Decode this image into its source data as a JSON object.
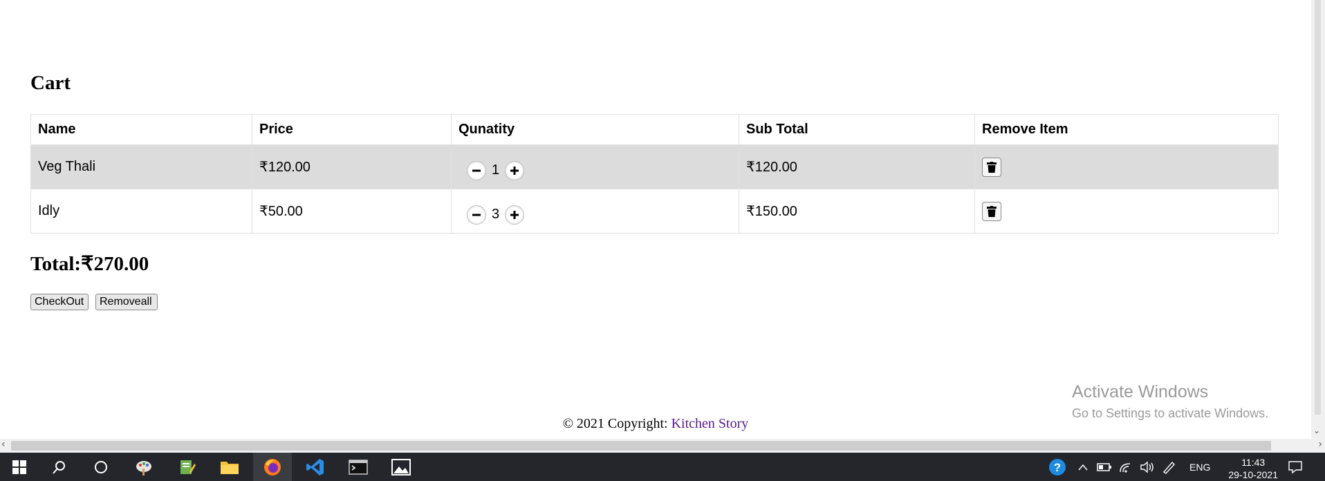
{
  "cart": {
    "title": "Cart",
    "columns": [
      "Name",
      "Price",
      "Qunatity",
      "Sub Total",
      "Remove Item"
    ],
    "rows": [
      {
        "name": "Veg Thali",
        "price": "₹120.00",
        "quantity": "1",
        "subtotal": "₹120.00"
      },
      {
        "name": "Idly",
        "price": "₹50.00",
        "quantity": "3",
        "subtotal": "₹150.00"
      }
    ],
    "total": "Total:₹270.00",
    "checkout_label": "CheckOut",
    "removeall_label": "Removeall"
  },
  "footer": {
    "copyright": "© 2021 Copyright: ",
    "link": "Kitchen Story"
  },
  "watermark": {
    "line1": "Activate Windows",
    "line2": "Go to Settings to activate Windows."
  },
  "taskbar": {
    "lang": "ENG",
    "time": "11:43",
    "date": "29-10-2021",
    "icons": [
      "windows-start-icon",
      "search-icon",
      "cortana-icon",
      "paint-icon",
      "notepad-icon",
      "file-explorer-icon",
      "firefox-icon",
      "vscode-icon",
      "terminal-icon",
      "photos-icon"
    ]
  }
}
